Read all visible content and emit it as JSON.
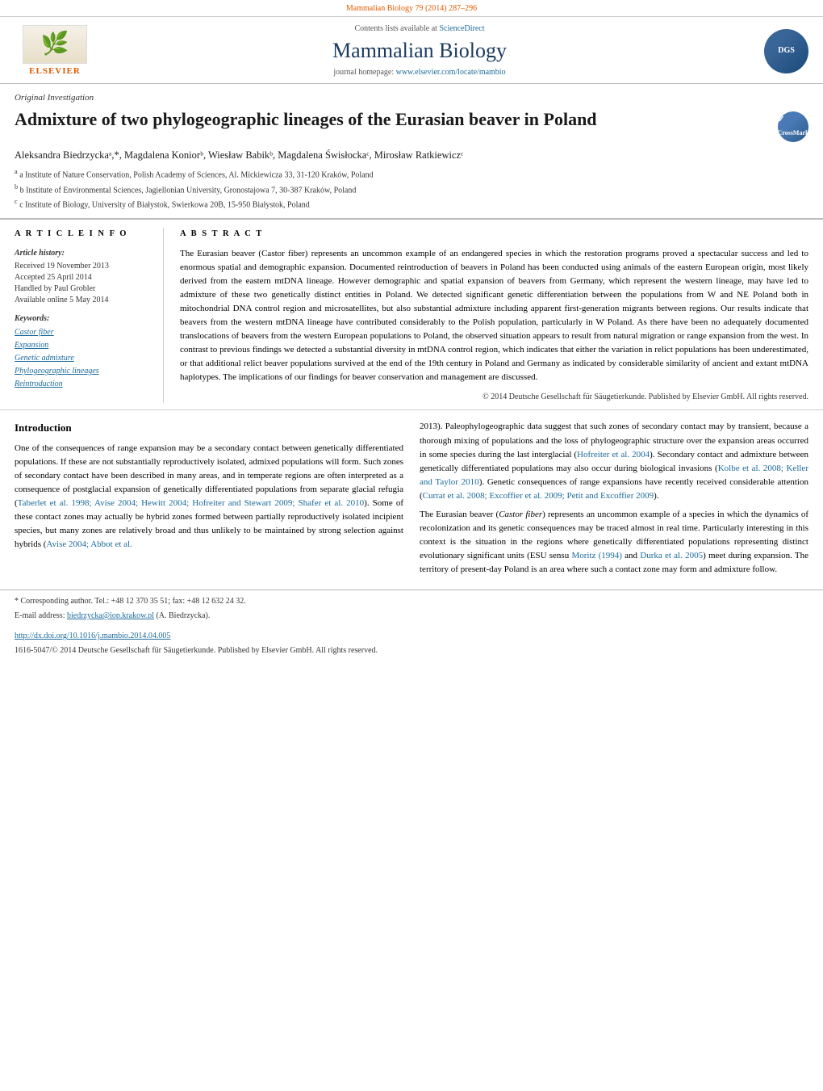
{
  "top_bar": {
    "text": "Mammalian Biology 79 (2014) 287–296"
  },
  "journal_header": {
    "contents_label": "Contents lists available at",
    "science_direct": "ScienceDirect",
    "journal_name": "Mammalian Biology",
    "homepage_label": "journal homepage:",
    "homepage_url": "www.elsevier.com/locate/mambio",
    "elsevier_label": "ELSEVIER"
  },
  "article": {
    "section_label": "Original Investigation",
    "title": "Admixture of two phylogeographic lineages of the Eurasian beaver in Poland",
    "crossmark_label": "CM",
    "authors": "Aleksandra Biedrzyckaᵃ,*, Magdalena Koniorᵇ, Wiesław Babikᵇ, Magdalena Świsłockaᶜ, Mirosław Ratkiewiczᶜ",
    "affiliations": [
      "a Institute of Nature Conservation, Polish Academy of Sciences, Al. Mickiewicza 33, 31-120 Kraków, Poland",
      "b Institute of Environmental Sciences, Jagiellonian University, Gronostajowa 7, 30-387 Kraków, Poland",
      "c Institute of Biology, University of Białystok, Swierkowa 20B, 15-950 Białystok, Poland"
    ]
  },
  "article_info": {
    "heading": "A R T I C L E   I N F O",
    "history_label": "Article history:",
    "received": "Received 19 November 2013",
    "accepted": "Accepted 25 April 2014",
    "handled": "Handled by Paul Grobler",
    "available": "Available online 5 May 2014",
    "keywords_label": "Keywords:",
    "keywords": [
      "Castor fiber",
      "Expansion",
      "Genetic admixture",
      "Phylogeographic lineages",
      "Reintroduction"
    ]
  },
  "abstract": {
    "heading": "A B S T R A C T",
    "text": "The Eurasian beaver (Castor fiber) represents an uncommon example of an endangered species in which the restoration programs proved a spectacular success and led to enormous spatial and demographic expansion. Documented reintroduction of beavers in Poland has been conducted using animals of the eastern European origin, most likely derived from the eastern mtDNA lineage. However demographic and spatial expansion of beavers from Germany, which represent the western lineage, may have led to admixture of these two genetically distinct entities in Poland. We detected significant genetic differentiation between the populations from W and NE Poland both in mitochondrial DNA control region and microsatellites, but also substantial admixture including apparent first-generation migrants between regions. Our results indicate that beavers from the western mtDNA lineage have contributed considerably to the Polish population, particularly in W Poland. As there have been no adequately documented translocations of beavers from the western European populations to Poland, the observed situation appears to result from natural migration or range expansion from the west. In contrast to previous findings we detected a substantial diversity in mtDNA control region, which indicates that either the variation in relict populations has been underestimated, or that additional relict beaver populations survived at the end of the 19th century in Poland and Germany as indicated by considerable similarity of ancient and extant mtDNA haplotypes. The implications of our findings for beaver conservation and management are discussed.",
    "copyright": "© 2014 Deutsche Gesellschaft für Säugetierkunde. Published by Elsevier GmbH. All rights reserved."
  },
  "introduction": {
    "heading": "Introduction",
    "paragraph1": "One of the consequences of range expansion may be a secondary contact between genetically differentiated populations. If these are not substantially reproductively isolated, admixed populations will form. Such zones of secondary contact have been described in many areas, and in temperate regions are often interpreted as a consequence of postglacial expansion of genetically differentiated populations from separate glacial refugia (Taberlet et al. 1998; Avise 2004; Hewitt 2004; Hofreiter and Stewart 2009; Shafer et al. 2010). Some of these contact zones may actually be hybrid zones formed between partially reproductively isolated incipient species, but many zones are relatively broad and thus unlikely to be maintained by strong selection against hybrids (Avise 2004; Abbot et al.",
    "paragraph2": "2013). Paleophylogeographic data suggest that such zones of secondary contact may by transient, because a thorough mixing of populations and the loss of phylogeographic structure over the expansion areas occurred in some species during the last interglacial (Hofreiter et al. 2004). Secondary contact and admixture between genetically differentiated populations may also occur during biological invasions (Kolbe et al. 2008; Keller and Taylor 2010). Genetic consequences of range expansions have recently received considerable attention (Currat et al. 2008; Excoffier et al. 2009; Petit and Excoffier 2009).",
    "paragraph3": "The Eurasian beaver (Castor fiber) represents an uncommon example of a species in which the dynamics of recolonization and its genetic consequences may be traced almost in real time. Particularly interesting in this context is the situation in the regions where genetically differentiated populations representing distinct evolutionary significant units (ESU sensu Moritz (1994) and Durka et al. 2005) meet during expansion. The territory of present-day Poland is an area where such a contact zone may form and admixture follow."
  },
  "footnote": {
    "corresponding": "* Corresponding author. Tel.: +48 12 370 35 51; fax: +48 12 632 24 32.",
    "email_label": "E-mail address:",
    "email": "biedrzycka@iop.krakow.pl",
    "email_suffix": "(A. Biedrzycka)."
  },
  "doi": {
    "url": "http://dx.doi.org/10.1016/j.mambio.2014.04.005"
  },
  "issn": {
    "text": "1616-5047/© 2014 Deutsche Gesellschaft für Säugetierkunde. Published by Elsevier GmbH. All rights reserved."
  }
}
